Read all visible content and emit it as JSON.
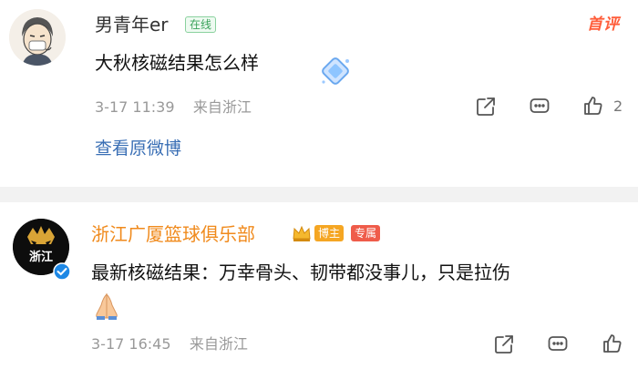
{
  "comments": [
    {
      "username": "男青年er",
      "online_badge": "在线",
      "text": "大秋核磁结果怎么样",
      "date": "3-17 11:39",
      "location": "来自浙江",
      "like_count": "2",
      "view_original": "查看原微博",
      "hot_label": "首评"
    },
    {
      "username": "浙江广厦篮球俱乐部",
      "avatar_text": "浙江",
      "badge_boss": "博主",
      "badge_exclusive": "专属",
      "text": "最新核磁结果：万幸骨头、韧带都没事儿，只是拉伤",
      "date": "3-17 16:45",
      "location": "来自浙江"
    }
  ],
  "icons": {
    "share": "share-icon",
    "comment": "comment-icon",
    "like": "thumbs-up-icon",
    "verified": "verified-badge-icon",
    "crown": "crown-icon",
    "sticker": "diamond-sticker-icon",
    "pray": "pray-hands-icon"
  },
  "colors": {
    "username_vip": "#f08a1c",
    "link": "#3a6fb5",
    "online": "#3aa25a",
    "hot": "#ff5d3a",
    "meta": "#999999"
  }
}
